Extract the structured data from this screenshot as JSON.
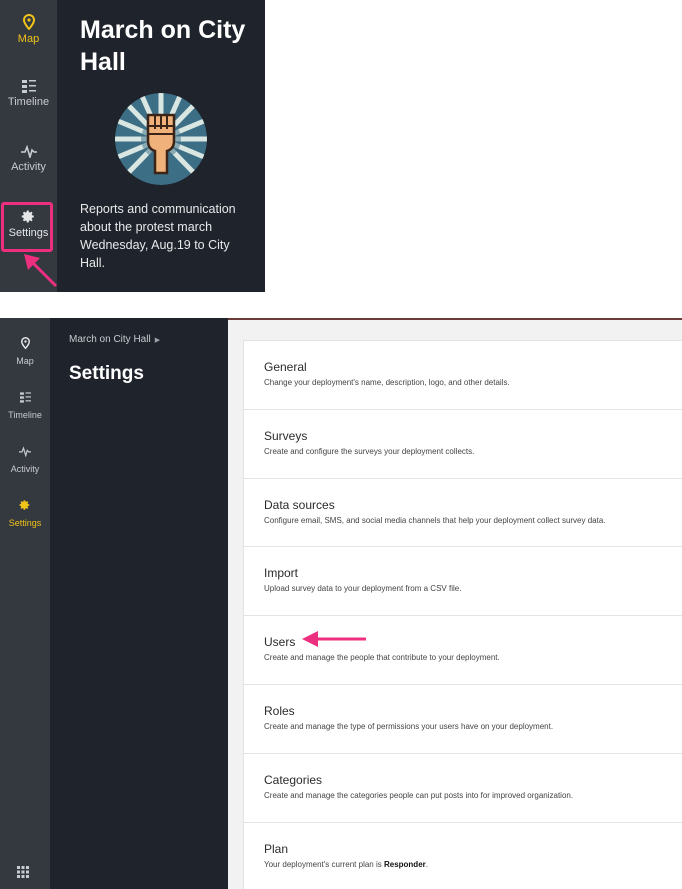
{
  "top": {
    "nav": [
      {
        "label": "Map",
        "icon": "map-pin-icon",
        "active": true
      },
      {
        "label": "Timeline",
        "icon": "timeline-icon",
        "active": false
      },
      {
        "label": "Activity",
        "icon": "activity-icon",
        "active": false
      },
      {
        "label": "Settings",
        "icon": "gear-icon",
        "active": false
      }
    ],
    "title": "March on City Hall",
    "description": "Reports and communication about the protest march Wednesday, Aug.19 to City Hall."
  },
  "bottom": {
    "nav": [
      {
        "label": "Map",
        "icon": "map-pin-icon",
        "active": false
      },
      {
        "label": "Timeline",
        "icon": "timeline-icon",
        "active": false
      },
      {
        "label": "Activity",
        "icon": "activity-icon",
        "active": false
      },
      {
        "label": "Settings",
        "icon": "gear-icon",
        "active": true
      }
    ],
    "breadcrumb": "March on City Hall",
    "title": "Settings",
    "cards": [
      {
        "title": "General",
        "desc": "Change your deployment's name, description, logo, and other details."
      },
      {
        "title": "Surveys",
        "desc": "Create and configure the surveys your deployment collects."
      },
      {
        "title": "Data sources",
        "desc": "Configure email, SMS, and social media channels that help your deployment collect survey data."
      },
      {
        "title": "Import",
        "desc": "Upload survey data to your deployment from a CSV file."
      },
      {
        "title": "Users",
        "desc": "Create and manage the people that contribute to your deployment."
      },
      {
        "title": "Roles",
        "desc": "Create and manage the type of permissions your users have on your deployment."
      },
      {
        "title": "Categories",
        "desc": "Create and manage the categories people can put posts into for improved organization."
      },
      {
        "title": "Plan",
        "desc_prefix": "Your deployment's current plan is ",
        "desc_bold": "Responder",
        "desc_suffix": "."
      }
    ]
  },
  "colors": {
    "rail": "#34383f",
    "sidebar": "#1f232b",
    "accent": "#f0c419",
    "highlight": "#ec2f7e",
    "main_bg": "#f2f2f2"
  }
}
